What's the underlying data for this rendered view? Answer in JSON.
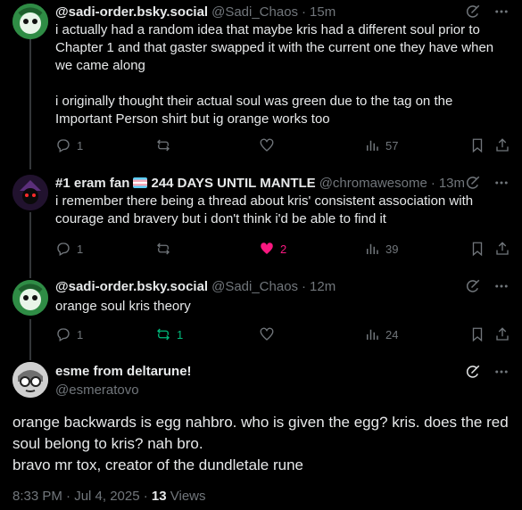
{
  "replies": [
    {
      "name": "@sadi-order.bsky.social",
      "handle": "@Sadi_Chaos",
      "time": "15m",
      "text": "i actually had a random idea that maybe kris had a different soul prior to Chapter 1 and that gaster swapped it with the current one they have when we came along\n\ni originally thought their actual soul was green due to the tag on the Important Person shirt but ig orange works too",
      "replies": "1",
      "reposts": "",
      "likes": "",
      "views": "57"
    },
    {
      "name_prefix": "#1 eram fan",
      "name_suffix": "244 DAYS UNTIL MANTLE",
      "handle": "@chromawesome",
      "time": "13m",
      "text": "i remember there being a thread about kris' consistent association with courage and bravery but i don't think i'd be able to find it",
      "replies": "1",
      "reposts": "",
      "likes": "2",
      "views": "39"
    },
    {
      "name": "@sadi-order.bsky.social",
      "handle": "@Sadi_Chaos",
      "time": "12m",
      "text": "orange soul kris theory",
      "replies": "1",
      "reposts": "1",
      "likes": "",
      "views": "24"
    }
  ],
  "main": {
    "name": "esme from deltarune!",
    "handle": "@esmeratovo",
    "text": "orange backwards is egg nahbro. who is given the egg? kris. does the red soul belong to kris? nah bro.\nbravo mr tox, creator of the dundletale rune",
    "time": "8:33 PM · Jul 4, 2025 · ",
    "views_count": "13",
    "views_label": " Views"
  },
  "colors": {
    "accent_green": "#00ba7c",
    "like_pink": "#f91880",
    "muted": "#71767b"
  }
}
